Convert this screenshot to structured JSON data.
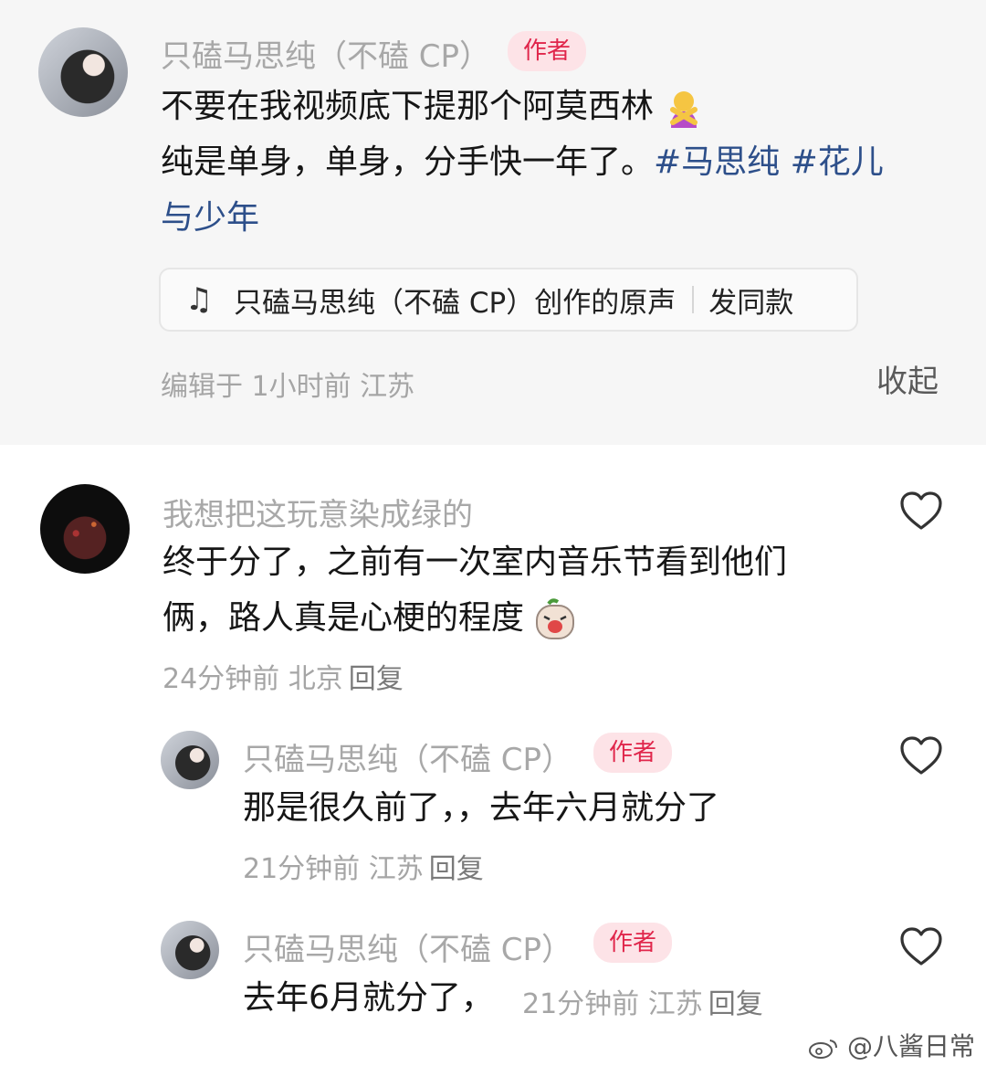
{
  "post": {
    "username": "只磕马思纯（不磕 CP）",
    "badge": "作者",
    "line1": "不要在我视频底下提那个阿莫西林",
    "line2": "纯是单身，单身，分手快一年了。",
    "tag1": "#马思纯",
    "tag2": "#花儿",
    "line3": "与少年",
    "sound_title": "只磕马思纯（不磕 CP）创作的原声",
    "sound_action": "发同款",
    "meta": "编辑于  1小时前  江苏",
    "collapse": "收起"
  },
  "comments": [
    {
      "username": "我想把这玩意染成绿的",
      "line1": "终于分了，之前有一次室内音乐节看到他们",
      "line2": "俩，路人真是心梗的程度",
      "meta": "24分钟前 北京",
      "reply": "回复"
    },
    {
      "username": "只磕马思纯（不磕 CP）",
      "badge": "作者",
      "line1": "那是很久前了，，去年六月就分了",
      "meta": "21分钟前 江苏",
      "reply": "回复"
    },
    {
      "username": "只磕马思纯（不磕 CP）",
      "badge": "作者",
      "line1": "去年6月就分了，",
      "meta": "21分钟前 江苏",
      "reply": "回复"
    }
  ],
  "watermark": "@八酱日常",
  "icons": {
    "music": "music-note-icon",
    "heart": "heart-outline-icon",
    "emoji_crossed": "person-gesturing-no-emoji",
    "emoji_cry": "crying-face-emoji",
    "weibo": "weibo-logo-icon"
  },
  "colors": {
    "badge_bg": "#fde3e7",
    "badge_text": "#e0264b",
    "hashtag": "#2d4f8a",
    "post_bg": "#f6f6f6"
  }
}
